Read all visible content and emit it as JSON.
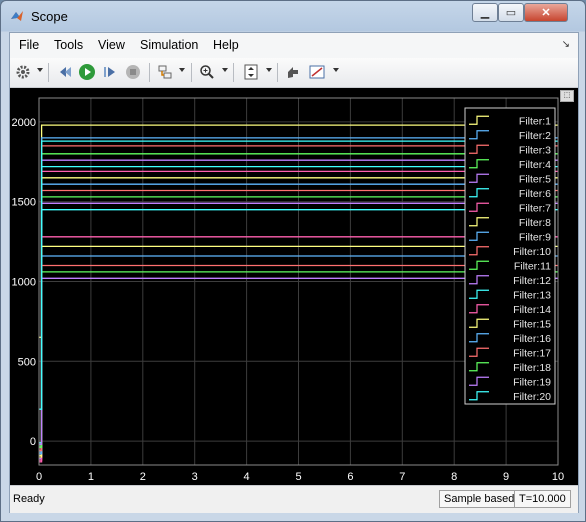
{
  "window": {
    "title": "Scope"
  },
  "menu": [
    "File",
    "Tools",
    "View",
    "Simulation",
    "Help"
  ],
  "toolbar_icons": [
    "gear-icon",
    "step-back-icon",
    "run-icon",
    "step-forward-icon",
    "stop-icon",
    "signal-select-icon",
    "zoom-in-icon",
    "autoscale-icon",
    "highlight-icon",
    "style-icon"
  ],
  "status": {
    "text": "Ready",
    "mode": "Sample based",
    "time": "T=10.000"
  },
  "colors": {
    "plot_bg": "#000000",
    "axes_bg": "#000000",
    "grid": "#3d3d3d",
    "axis_text": "#ffffff"
  },
  "chart_data": {
    "type": "line",
    "xlim": [
      0,
      10
    ],
    "ylim": [
      -150,
      2150
    ],
    "xticks": [
      "0",
      "1",
      "2",
      "3",
      "4",
      "5",
      "6",
      "7",
      "8",
      "9",
      "10"
    ],
    "yticks": [
      "0",
      "500",
      "1000",
      "1500",
      "2000"
    ],
    "grid": true,
    "legend_position": "top-right",
    "series": [
      {
        "name": "Filter:1",
        "color": "#ffff80",
        "values": [
          {
            "x": 0,
            "y": 650
          },
          {
            "x": 0.05,
            "y": 1980
          },
          {
            "x": 10,
            "y": 1980
          }
        ]
      },
      {
        "name": "Filter:2",
        "color": "#5fb8ff",
        "values": [
          {
            "x": 0,
            "y": -80
          },
          {
            "x": 0.05,
            "y": 1900
          },
          {
            "x": 10,
            "y": 1900
          }
        ]
      },
      {
        "name": "Filter:3",
        "color": "#ff7070",
        "values": [
          {
            "x": 0,
            "y": -100
          },
          {
            "x": 0.05,
            "y": 1850
          },
          {
            "x": 10,
            "y": 1850
          }
        ]
      },
      {
        "name": "Filter:4",
        "color": "#60ff60",
        "values": [
          {
            "x": 0,
            "y": -60
          },
          {
            "x": 0.05,
            "y": 1800
          },
          {
            "x": 10,
            "y": 1800
          }
        ]
      },
      {
        "name": "Filter:5",
        "color": "#c080ff",
        "values": [
          {
            "x": 0,
            "y": -40
          },
          {
            "x": 0.05,
            "y": 1760
          },
          {
            "x": 10,
            "y": 1760
          }
        ]
      },
      {
        "name": "Filter:6",
        "color": "#40ffff",
        "values": [
          {
            "x": 0,
            "y": -20
          },
          {
            "x": 0.05,
            "y": 1720
          },
          {
            "x": 10,
            "y": 1720
          }
        ]
      },
      {
        "name": "Filter:7",
        "color": "#ff60b0",
        "values": [
          {
            "x": 0,
            "y": -120
          },
          {
            "x": 0.05,
            "y": 1690
          },
          {
            "x": 10,
            "y": 1690
          }
        ]
      },
      {
        "name": "Filter:8",
        "color": "#ffff80",
        "values": [
          {
            "x": 0,
            "y": -90
          },
          {
            "x": 0.05,
            "y": 1650
          },
          {
            "x": 10,
            "y": 1650
          }
        ]
      },
      {
        "name": "Filter:9",
        "color": "#5fb8ff",
        "values": [
          {
            "x": 0,
            "y": -70
          },
          {
            "x": 0.05,
            "y": 1610
          },
          {
            "x": 10,
            "y": 1610
          }
        ]
      },
      {
        "name": "Filter:10",
        "color": "#ff7070",
        "values": [
          {
            "x": 0,
            "y": -50
          },
          {
            "x": 0.05,
            "y": 1570
          },
          {
            "x": 10,
            "y": 1570
          }
        ]
      },
      {
        "name": "Filter:11",
        "color": "#60ff60",
        "values": [
          {
            "x": 0,
            "y": -30
          },
          {
            "x": 0.05,
            "y": 1530
          },
          {
            "x": 10,
            "y": 1530
          }
        ]
      },
      {
        "name": "Filter:12",
        "color": "#c080ff",
        "values": [
          {
            "x": 0,
            "y": -110
          },
          {
            "x": 0.05,
            "y": 1490
          },
          {
            "x": 10,
            "y": 1490
          }
        ]
      },
      {
        "name": "Filter:13",
        "color": "#40ffff",
        "values": [
          {
            "x": 0,
            "y": -10
          },
          {
            "x": 0.05,
            "y": 1450
          },
          {
            "x": 10,
            "y": 1450
          }
        ]
      },
      {
        "name": "Filter:14",
        "color": "#ff60b0",
        "values": [
          {
            "x": 0,
            "y": -130
          },
          {
            "x": 0.05,
            "y": 1280
          },
          {
            "x": 10,
            "y": 1280
          }
        ]
      },
      {
        "name": "Filter:15",
        "color": "#ffff80",
        "values": [
          {
            "x": 0,
            "y": -100
          },
          {
            "x": 0.05,
            "y": 1220
          },
          {
            "x": 10,
            "y": 1220
          }
        ]
      },
      {
        "name": "Filter:16",
        "color": "#5fb8ff",
        "values": [
          {
            "x": 0,
            "y": -80
          },
          {
            "x": 0.05,
            "y": 1160
          },
          {
            "x": 10,
            "y": 1160
          }
        ]
      },
      {
        "name": "Filter:17",
        "color": "#ff7070",
        "values": [
          {
            "x": 0,
            "y": -60
          },
          {
            "x": 0.05,
            "y": 1100
          },
          {
            "x": 10,
            "y": 1100
          }
        ]
      },
      {
        "name": "Filter:18",
        "color": "#60ff60",
        "values": [
          {
            "x": 0,
            "y": -40
          },
          {
            "x": 0.05,
            "y": 1060
          },
          {
            "x": 10,
            "y": 1060
          }
        ]
      },
      {
        "name": "Filter:19",
        "color": "#c080ff",
        "values": [
          {
            "x": 0,
            "y": -20
          },
          {
            "x": 0.05,
            "y": 1020
          },
          {
            "x": 10,
            "y": 1020
          }
        ]
      },
      {
        "name": "Filter:20",
        "color": "#40ffff",
        "values": [
          {
            "x": 0,
            "y": 200
          },
          {
            "x": 0.05,
            "y": 1880
          },
          {
            "x": 10,
            "y": 1880
          }
        ]
      }
    ]
  }
}
